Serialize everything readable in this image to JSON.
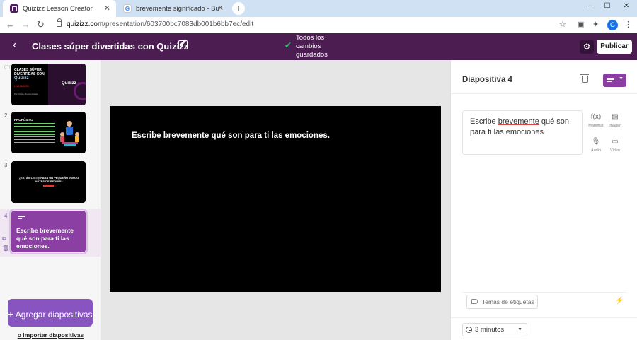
{
  "browser": {
    "tabs": [
      {
        "title": "Quizizz Lesson Creator",
        "active": true,
        "icon": "quizizz-favicon"
      },
      {
        "title": "brevemente significado - Buscar",
        "active": false,
        "icon": "google-favicon"
      }
    ],
    "url_host": "quizizz.com",
    "url_path": "/presentation/603700bc7083db001b6bb7ec/edit",
    "profile_initial": "G",
    "new_tab": "+",
    "minimize": "–",
    "maximize": "☐",
    "close": "✕"
  },
  "app": {
    "lesson_title": "Clases súper divertidas con Quizizz",
    "save_status": "Todos los cambios guardados",
    "publish_label": "Publicar",
    "colors": {
      "header_bg": "#4b1d51",
      "accent": "#8854c0",
      "slide_bg": "#000000",
      "success": "#35c26a"
    }
  },
  "slides": [
    {
      "number": "",
      "title_line": "CLASES SÚPER DIVERTIDAS CON",
      "brand": "Quizizz",
      "subtitle": "UNA MISIÓN",
      "author": "Por: Italian Rivera Rosas",
      "logo": "Quizizz"
    },
    {
      "number": "2",
      "heading": "PROPÓSITO"
    },
    {
      "number": "3",
      "text": "¿ESTÁS LIST@ PARA UN PEQUEÑO JUEGO ANTES DE SEGUIR?"
    },
    {
      "number": "4",
      "text": "Escribe brevemente qué son para ti las emociones."
    }
  ],
  "sidebar": {
    "add_label": "Agregar diapositivas",
    "add_plus": "+",
    "import_label": "o importar diapositivas"
  },
  "canvas": {
    "slide_text": "Escribe brevemente qué son para ti las emociones."
  },
  "panel": {
    "title": "Diapositiva 4",
    "text_before": "Escribe ",
    "text_underlined": "brevemente",
    "text_after": " qué son para ti las emociones.",
    "tools": [
      {
        "label": "Matemát",
        "icon": "function-icon"
      },
      {
        "label": "Imagen",
        "icon": "image-icon"
      },
      {
        "label": "Audio",
        "icon": "microphone-icon"
      },
      {
        "label": "Video",
        "icon": "video-icon"
      }
    ],
    "tags_label": "Temas de etiquetas",
    "time_label": "3 minutos"
  }
}
